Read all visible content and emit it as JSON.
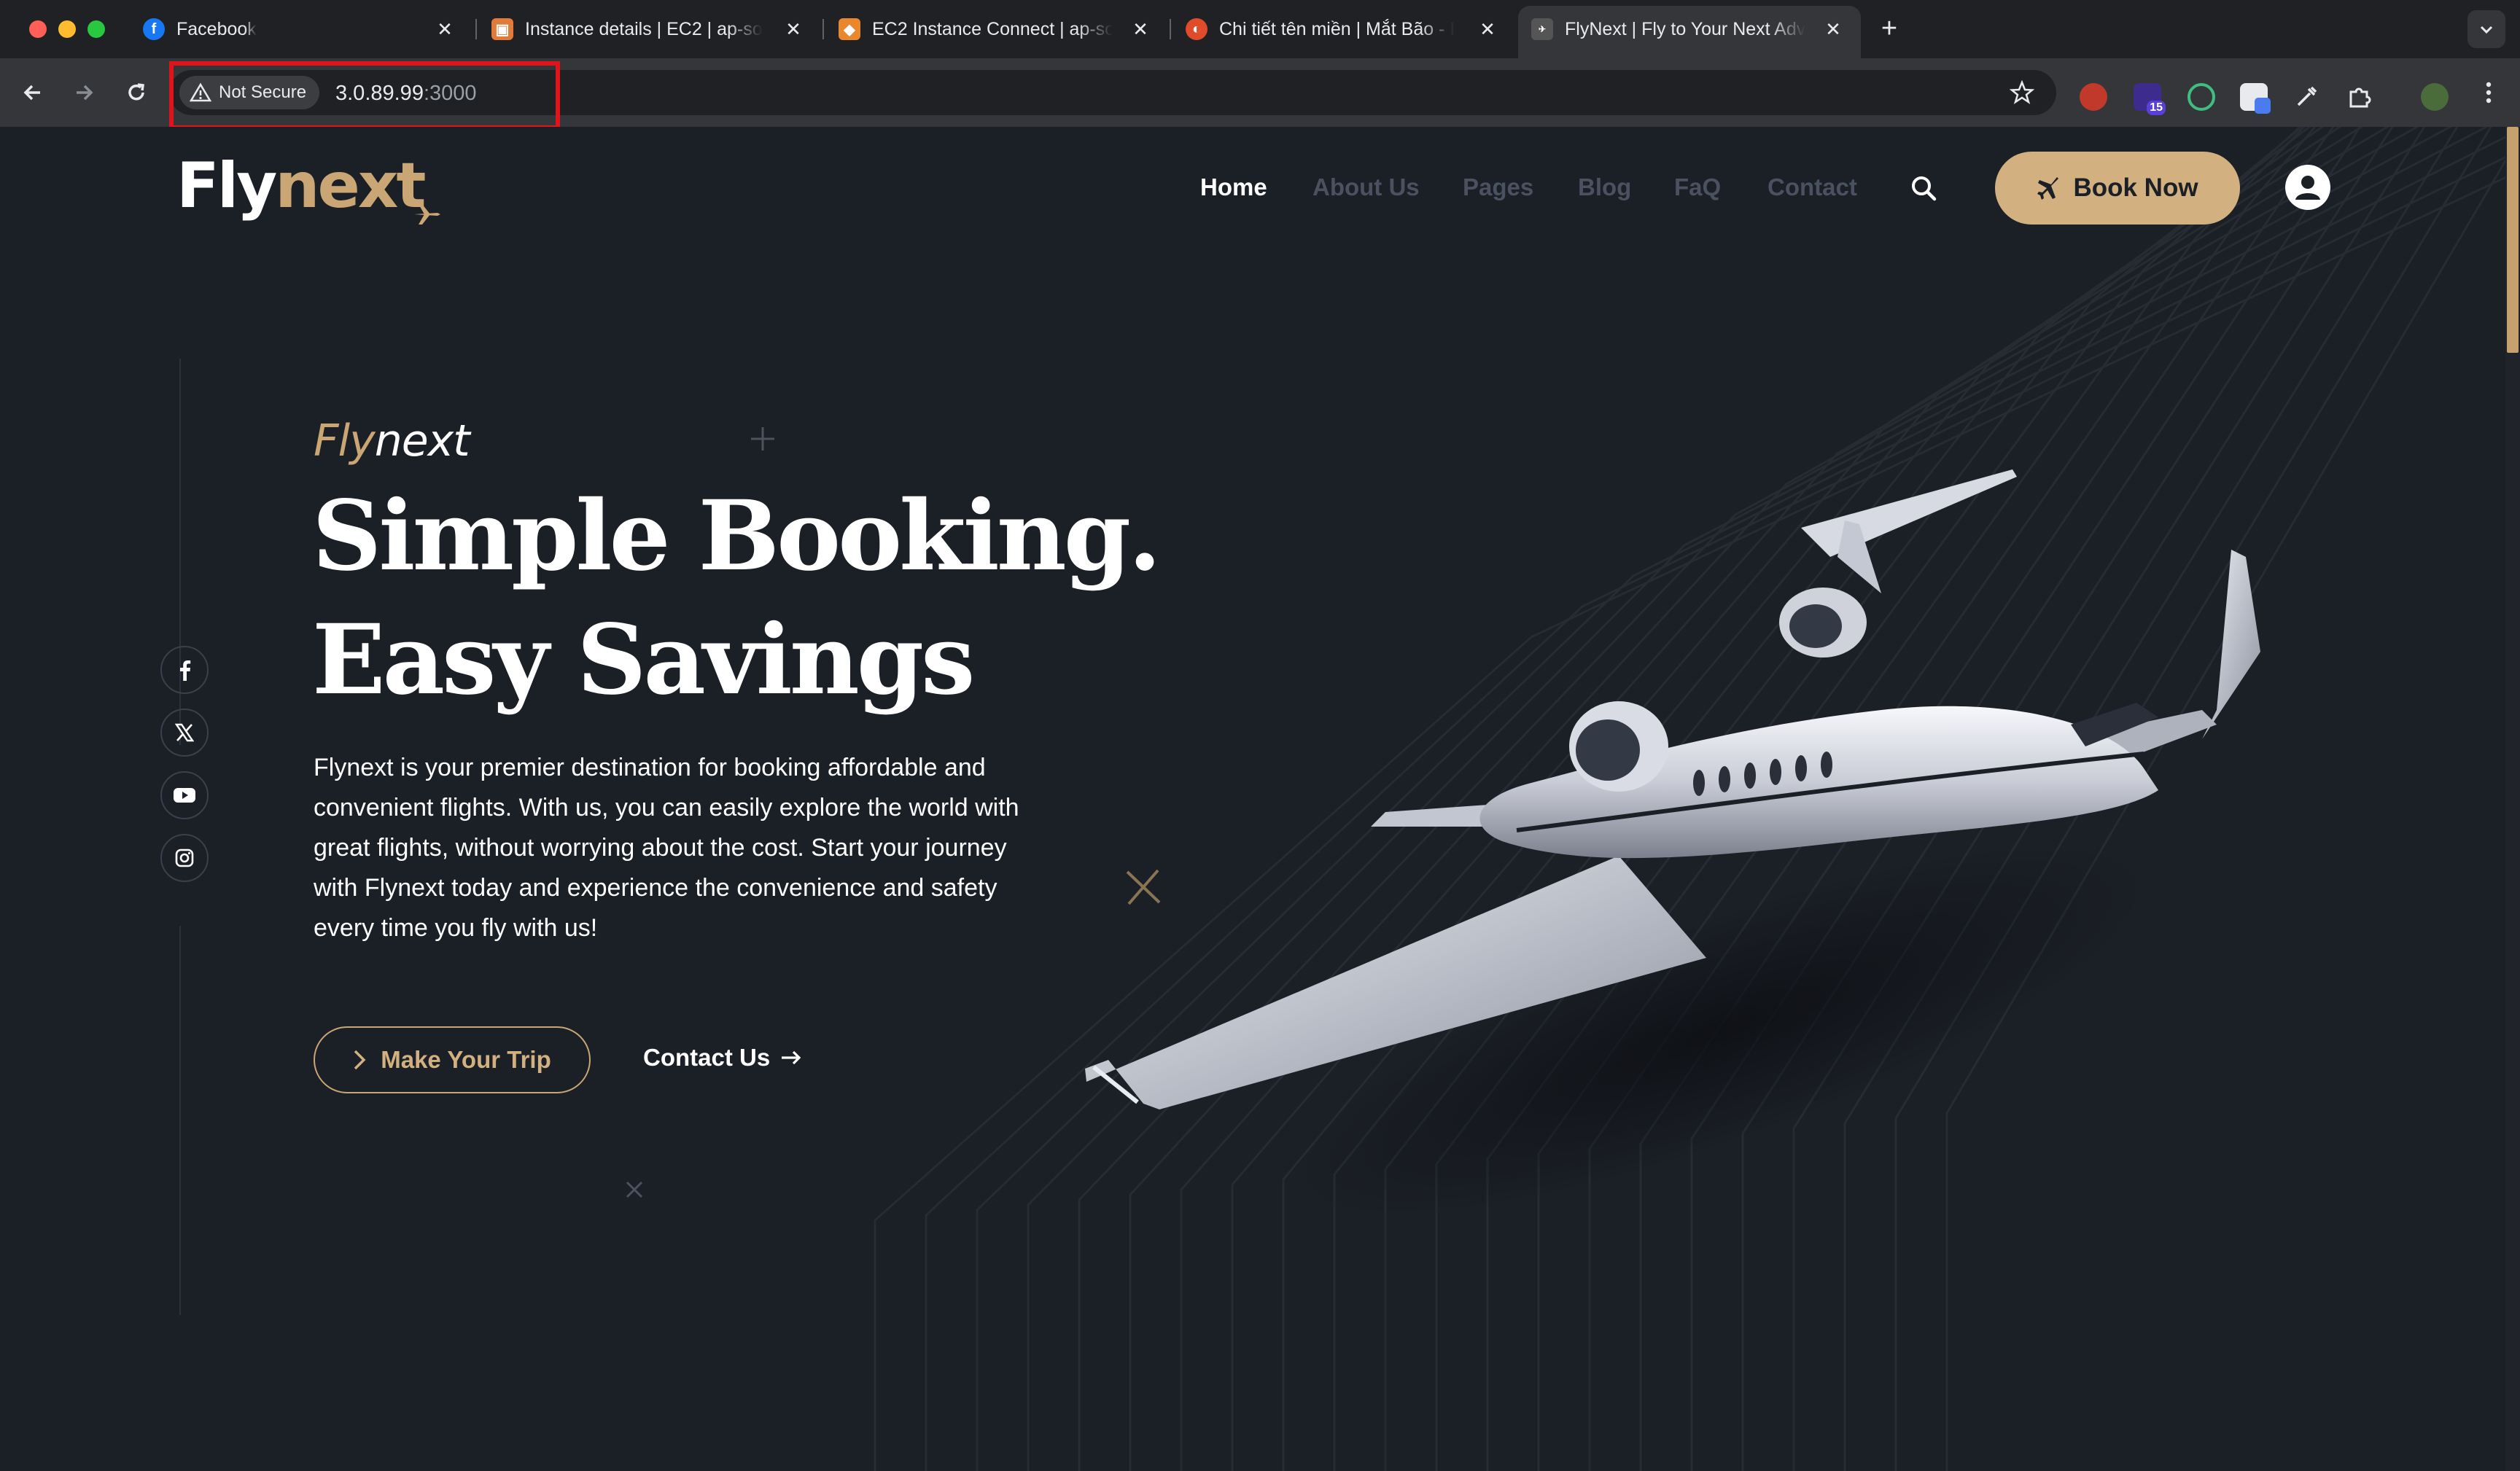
{
  "browser": {
    "tabs": [
      {
        "title": "Facebook",
        "favicon": "facebook-icon"
      },
      {
        "title": "Instance details | EC2 | ap-so",
        "favicon": "aws-icon"
      },
      {
        "title": "EC2 Instance Connect | ap-so",
        "favicon": "aws-cube-icon"
      },
      {
        "title": "Chi tiết tên miền | Mắt Bão - I",
        "favicon": "matbao-icon"
      },
      {
        "title": "FlyNext | Fly to Your Next Adv",
        "favicon": "flynext-icon"
      }
    ],
    "security_label": "Not Secure",
    "url_host": "3.0.89.99",
    "url_port": ":3000",
    "extension_badge": "15"
  },
  "site": {
    "logo_part1": "Fly",
    "logo_part2": "next",
    "nav": [
      "Home",
      "About Us",
      "Pages",
      "Blog",
      "FaQ",
      "Contact"
    ],
    "book_now": "Book Now",
    "accent_color": "#d2b07f"
  },
  "hero": {
    "eyebrow_part1": "Fly",
    "eyebrow_part2": "next",
    "headline_line1": "Simple Booking.",
    "headline_line2": "Easy Savings",
    "description": "Flynext is your premier destination for booking affordable and convenient flights. With us, you can easily explore the world with great flights, without worrying about the cost. Start your journey with Flynext today and experience the convenience and safety every time you fly with us!",
    "primary_button": "Make Your Trip",
    "secondary_link": "Contact Us"
  },
  "social": [
    "facebook-icon",
    "x-icon",
    "youtube-icon",
    "instagram-icon"
  ]
}
